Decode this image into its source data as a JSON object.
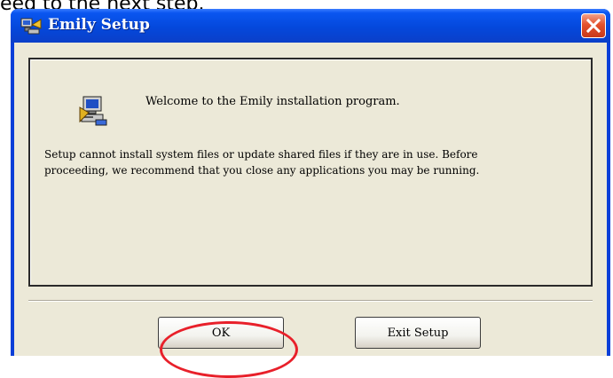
{
  "page": {
    "caption_fragment": "eed to the next step."
  },
  "window": {
    "title": "Emily Setup",
    "icons": {
      "title": "setup-app-icon",
      "close": "close-icon",
      "content": "computer-setup-icon"
    },
    "close_color": "#e4512c"
  },
  "content": {
    "welcome": "Welcome to the Emily installation program.",
    "notice_line1": "Setup cannot install system files or update shared files if they are in use.  Before",
    "notice_line2": "proceeding, we recommend that you close any applications you may be running."
  },
  "buttons": {
    "ok": "OK",
    "exit": "Exit Setup"
  },
  "annotation": {
    "color": "#e8202a",
    "target": "OK"
  }
}
